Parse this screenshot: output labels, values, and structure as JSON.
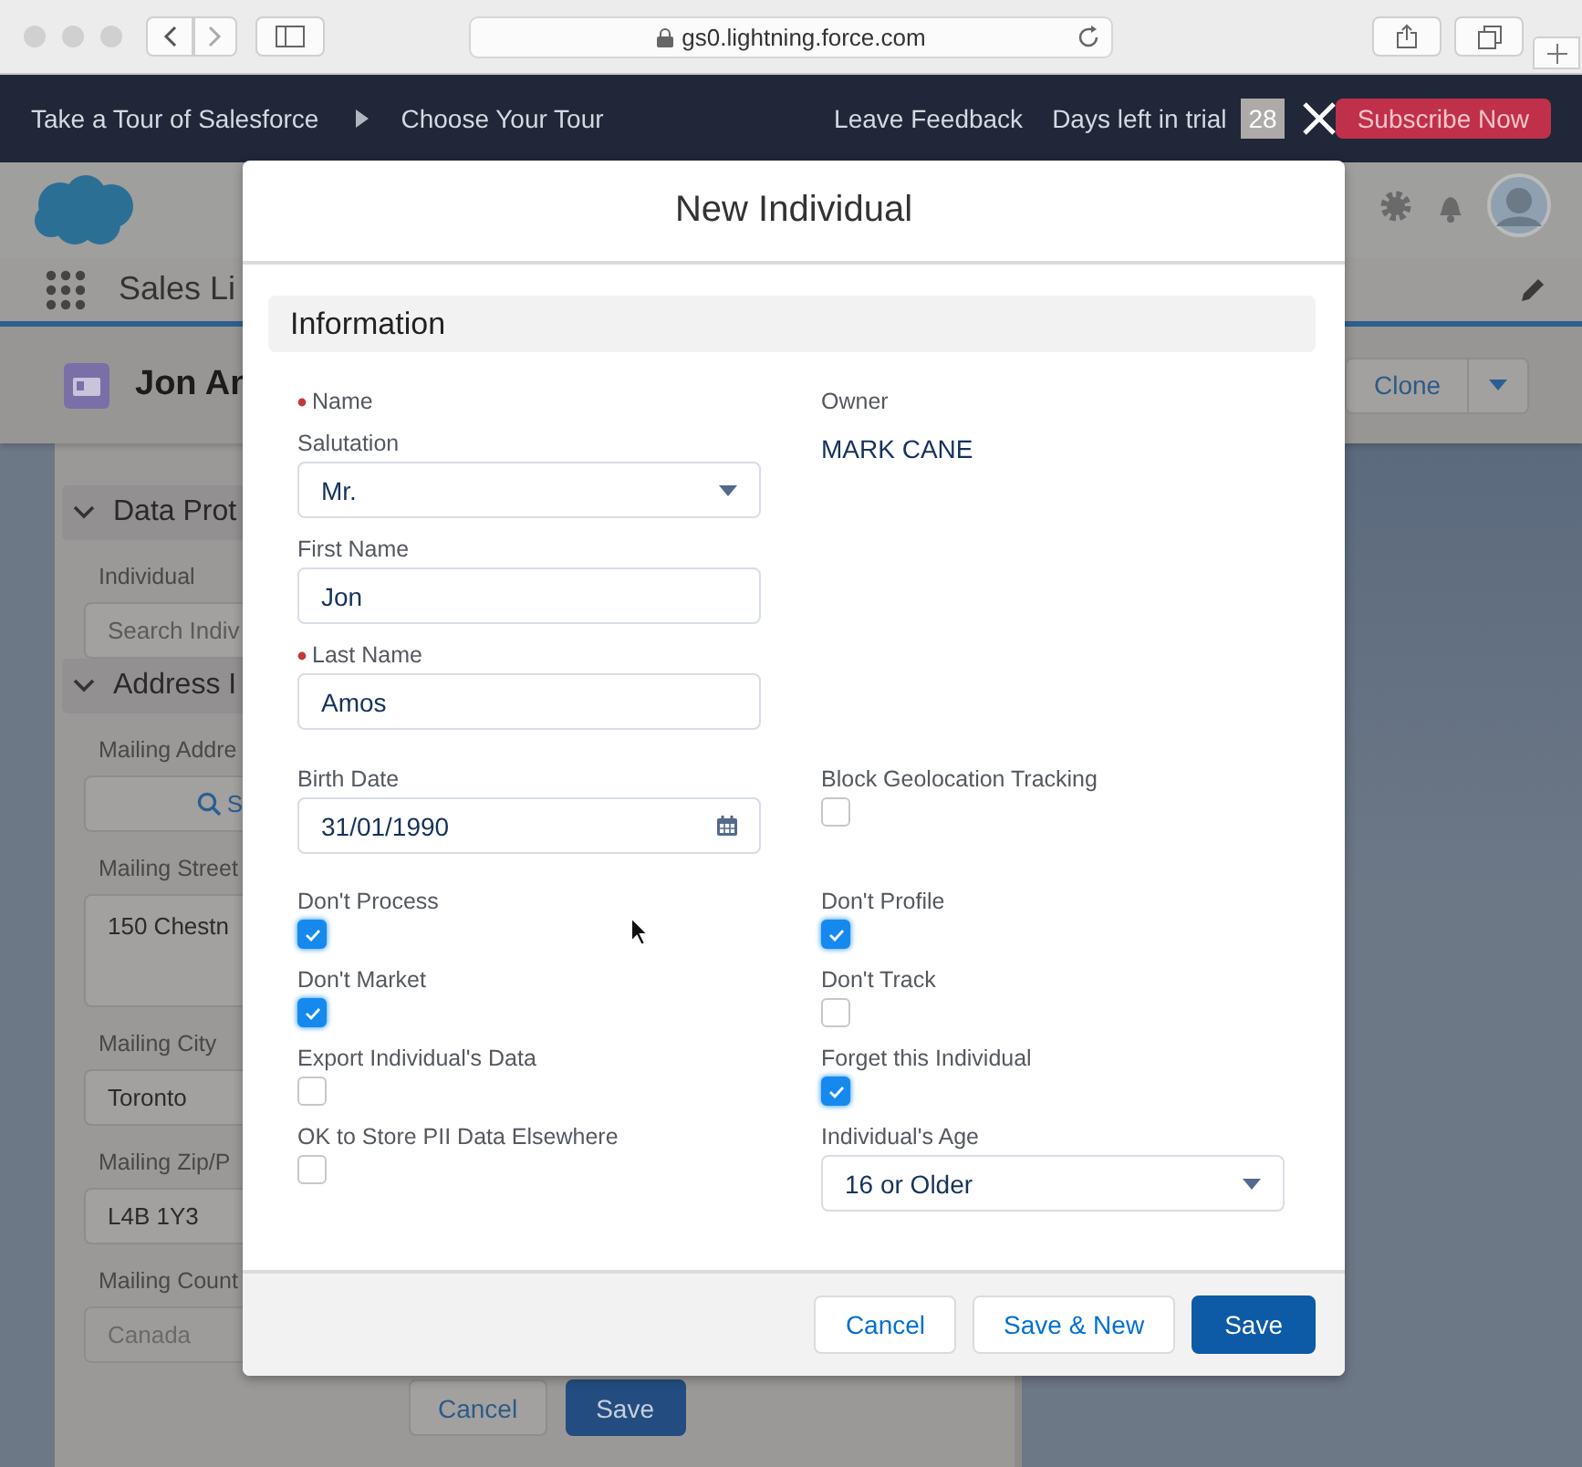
{
  "browser": {
    "url": "gs0.lightning.force.com"
  },
  "tour_bar": {
    "breadcrumbs": [
      "Take a Tour of Salesforce",
      "Choose Your Tour"
    ],
    "feedback": "Leave Feedback",
    "trial_label": "Days left in trial",
    "trial_days": "28",
    "subscribe": "Subscribe Now"
  },
  "app": {
    "app_name": "Sales Li",
    "record_title": "Jon An",
    "record_actions": [
      "Clone"
    ],
    "form": [
      {
        "kind": "section",
        "title": "Data Prot",
        "expanded": true
      },
      {
        "kind": "field",
        "label": "Individual",
        "placeholder": "Search Indiv"
      },
      {
        "kind": "section",
        "title": "Address I",
        "expanded": true
      },
      {
        "kind": "search",
        "label": "Mailing Addre",
        "value": "S"
      },
      {
        "kind": "textarea",
        "label": "Mailing Street",
        "value": "150 Chestn"
      },
      {
        "kind": "field",
        "label": "Mailing City",
        "value": "Toronto"
      },
      {
        "kind": "field",
        "label": "Mailing Zip/P",
        "value": "L4B 1Y3"
      },
      {
        "kind": "field",
        "label": "Mailing Count",
        "value": "Canada",
        "disabled": true
      }
    ],
    "buttons": [
      {
        "label": "Cancel",
        "kind": "neutral"
      },
      {
        "label": "Save",
        "kind": "brand"
      }
    ]
  },
  "modal": {
    "title": "New Individual",
    "section": "Information",
    "left": [
      {
        "kind": "heading",
        "label": "Name",
        "required": true
      },
      {
        "kind": "select",
        "label": "Salutation",
        "value": "Mr."
      },
      {
        "kind": "text",
        "label": "First Name",
        "value": "Jon"
      },
      {
        "kind": "text",
        "label": "Last Name",
        "value": "Amos",
        "required": true
      }
    ],
    "right": [
      {
        "kind": "value",
        "label": "Owner",
        "value": "MARK CANE"
      }
    ],
    "grid": [
      {
        "kind": "date",
        "label": "Birth Date",
        "value": "31/01/1990"
      },
      {
        "kind": "checkbox",
        "label": "Block Geolocation Tracking",
        "checked": false
      },
      {
        "kind": "checkbox",
        "label": "Don't Process",
        "checked": true
      },
      {
        "kind": "checkbox",
        "label": "Don't Profile",
        "checked": true
      },
      {
        "kind": "checkbox",
        "label": "Don't Market",
        "checked": true
      },
      {
        "kind": "checkbox",
        "label": "Don't Track",
        "checked": false
      },
      {
        "kind": "checkbox",
        "label": "Export Individual's Data",
        "checked": false
      },
      {
        "kind": "checkbox",
        "label": "Forget this Individual",
        "checked": true
      },
      {
        "kind": "checkbox",
        "label": "OK to Store PII Data Elsewhere",
        "checked": false
      },
      {
        "kind": "select",
        "label": "Individual's Age",
        "value": "16 or Older"
      }
    ],
    "buttons": [
      {
        "label": "Cancel",
        "kind": "neutral"
      },
      {
        "label": "Save & New",
        "kind": "neutral"
      },
      {
        "label": "Save",
        "kind": "brand"
      }
    ]
  }
}
